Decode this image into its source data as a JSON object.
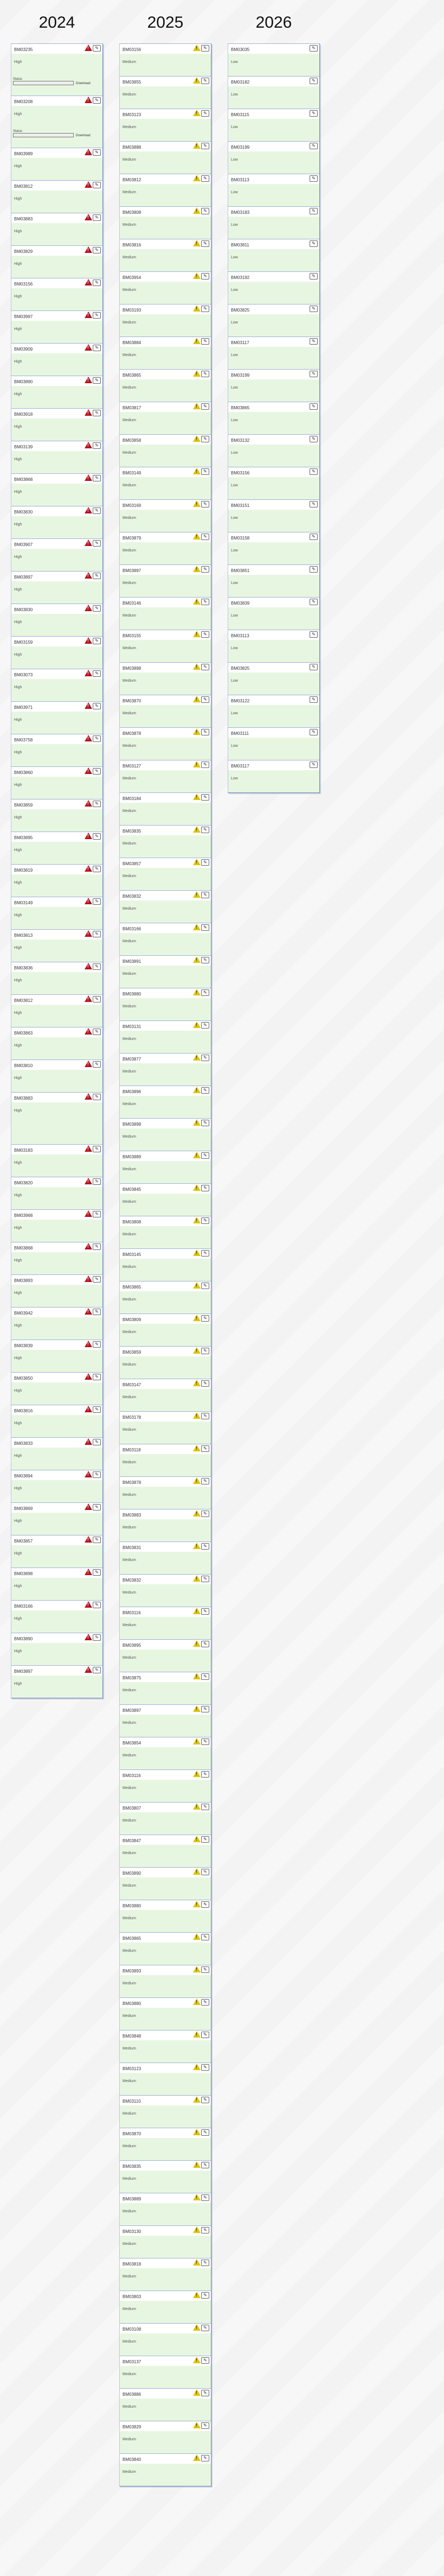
{
  "years": [
    {
      "label": "2024",
      "severity": "High",
      "cards": [
        {
          "id": "BM03235",
          "level": "High",
          "kind": "extra"
        },
        {
          "id": "BM03208",
          "level": "High",
          "kind": "extra2"
        },
        {
          "id": "BM03989",
          "level": "High"
        },
        {
          "id": "BM03812",
          "level": "High"
        },
        {
          "id": "BM03883",
          "level": "High"
        },
        {
          "id": "BM03829",
          "level": "High"
        },
        {
          "id": "BM03156",
          "level": "High"
        },
        {
          "id": "BM03997",
          "level": "High"
        },
        {
          "id": "BM03909",
          "level": "High"
        },
        {
          "id": "BM03890",
          "level": "High"
        },
        {
          "id": "BM03918",
          "level": "High"
        },
        {
          "id": "BM03139",
          "level": "High"
        },
        {
          "id": "BM03868",
          "level": "High"
        },
        {
          "id": "BM03830",
          "level": "High"
        },
        {
          "id": "BM03907",
          "level": "High"
        },
        {
          "id": "BM03897",
          "level": "High"
        },
        {
          "id": "BM03830",
          "level": "High"
        },
        {
          "id": "BM03159",
          "level": "High"
        },
        {
          "id": "BM03073",
          "level": "High"
        },
        {
          "id": "BM03971",
          "level": "High"
        },
        {
          "id": "BM03758",
          "level": "High"
        },
        {
          "id": "BM03860",
          "level": "High"
        },
        {
          "id": "BM03859",
          "level": "High"
        },
        {
          "id": "BM03895",
          "level": "High"
        },
        {
          "id": "BM03819",
          "level": "High"
        },
        {
          "id": "BM03149",
          "level": "High"
        },
        {
          "id": "BM03813",
          "level": "High"
        },
        {
          "id": "BM03836",
          "level": "High"
        },
        {
          "id": "BM03812",
          "level": "High"
        },
        {
          "id": "BM03863",
          "level": "High"
        },
        {
          "id": "BM03810",
          "level": "High"
        },
        {
          "id": "BM03883",
          "level": "High",
          "kind": "big"
        },
        {
          "id": "BM03183",
          "level": "High"
        },
        {
          "id": "BM03820",
          "level": "High"
        },
        {
          "id": "BM03968",
          "level": "High"
        },
        {
          "id": "BM03868",
          "level": "High"
        },
        {
          "id": "BM03893",
          "level": "High"
        },
        {
          "id": "BM03942",
          "level": "High"
        },
        {
          "id": "BM03839",
          "level": "High"
        },
        {
          "id": "BM03850",
          "level": "High"
        },
        {
          "id": "BM03816",
          "level": "High"
        },
        {
          "id": "BM03833",
          "level": "High"
        },
        {
          "id": "BM03894",
          "level": "High"
        },
        {
          "id": "BM03869",
          "level": "High"
        },
        {
          "id": "BM03857",
          "level": "High"
        },
        {
          "id": "BM03898",
          "level": "High"
        },
        {
          "id": "BM03166",
          "level": "High"
        },
        {
          "id": "BM03890",
          "level": "High"
        },
        {
          "id": "BM03897",
          "level": "High"
        }
      ]
    },
    {
      "label": "2025",
      "severity": "Medium",
      "cards": [
        {
          "id": "BM03156",
          "level": "Medium"
        },
        {
          "id": "BM03855",
          "level": "Medium"
        },
        {
          "id": "BM03123",
          "level": "Medium"
        },
        {
          "id": "BM03888",
          "level": "Medium"
        },
        {
          "id": "BM03812",
          "level": "Medium"
        },
        {
          "id": "BM03808",
          "level": "Medium"
        },
        {
          "id": "BM03816",
          "level": "Medium"
        },
        {
          "id": "BM03954",
          "level": "Medium"
        },
        {
          "id": "BM03193",
          "level": "Medium"
        },
        {
          "id": "BM03884",
          "level": "Medium"
        },
        {
          "id": "BM03865",
          "level": "Medium"
        },
        {
          "id": "BM03817",
          "level": "Medium"
        },
        {
          "id": "BM03858",
          "level": "Medium"
        },
        {
          "id": "BM03149",
          "level": "Medium"
        },
        {
          "id": "BM03169",
          "level": "Medium"
        },
        {
          "id": "BM03879",
          "level": "Medium"
        },
        {
          "id": "BM03897",
          "level": "Medium"
        },
        {
          "id": "BM03146",
          "level": "Medium"
        },
        {
          "id": "BM03155",
          "level": "Medium"
        },
        {
          "id": "BM03898",
          "level": "Medium"
        },
        {
          "id": "BM03870",
          "level": "Medium"
        },
        {
          "id": "BM03878",
          "level": "Medium"
        },
        {
          "id": "BM03127",
          "level": "Medium"
        },
        {
          "id": "BM03184",
          "level": "Medium"
        },
        {
          "id": "BM03835",
          "level": "Medium"
        },
        {
          "id": "BM03857",
          "level": "Medium"
        },
        {
          "id": "BM03832",
          "level": "Medium"
        },
        {
          "id": "BM03166",
          "level": "Medium"
        },
        {
          "id": "BM03891",
          "level": "Medium"
        },
        {
          "id": "BM03880",
          "level": "Medium"
        },
        {
          "id": "BM03131",
          "level": "Medium"
        },
        {
          "id": "BM03877",
          "level": "Medium"
        },
        {
          "id": "BM03896",
          "level": "Medium"
        },
        {
          "id": "BM03898",
          "level": "Medium"
        },
        {
          "id": "BM03889",
          "level": "Medium"
        },
        {
          "id": "BM03845",
          "level": "Medium"
        },
        {
          "id": "BM03808",
          "level": "Medium"
        },
        {
          "id": "BM03145",
          "level": "Medium"
        },
        {
          "id": "BM03865",
          "level": "Medium"
        },
        {
          "id": "BM03809",
          "level": "Medium"
        },
        {
          "id": "BM03859",
          "level": "Medium"
        },
        {
          "id": "BM03147",
          "level": "Medium"
        },
        {
          "id": "BM03178",
          "level": "Medium"
        },
        {
          "id": "BM03118",
          "level": "Medium"
        },
        {
          "id": "BM03878",
          "level": "Medium"
        },
        {
          "id": "BM03883",
          "level": "Medium"
        },
        {
          "id": "BM03831",
          "level": "Medium"
        },
        {
          "id": "BM03832",
          "level": "Medium"
        },
        {
          "id": "BM03116",
          "level": "Medium"
        },
        {
          "id": "BM03895",
          "level": "Medium"
        },
        {
          "id": "BM03875",
          "level": "Medium"
        },
        {
          "id": "BM03897",
          "level": "Medium"
        },
        {
          "id": "BM03854",
          "level": "Medium"
        },
        {
          "id": "BM03116",
          "level": "Medium"
        },
        {
          "id": "BM03807",
          "level": "Medium"
        },
        {
          "id": "BM03847",
          "level": "Medium"
        },
        {
          "id": "BM03890",
          "level": "Medium"
        },
        {
          "id": "BM03880",
          "level": "Medium"
        },
        {
          "id": "BM03865",
          "level": "Medium"
        },
        {
          "id": "BM03893",
          "level": "Medium"
        },
        {
          "id": "BM03880",
          "level": "Medium"
        },
        {
          "id": "BM03848",
          "level": "Medium"
        },
        {
          "id": "BM03123",
          "level": "Medium"
        },
        {
          "id": "BM03110",
          "level": "Medium"
        },
        {
          "id": "BM03870",
          "level": "Medium"
        },
        {
          "id": "BM03835",
          "level": "Medium"
        },
        {
          "id": "BM03889",
          "level": "Medium"
        },
        {
          "id": "BM03130",
          "level": "Medium"
        },
        {
          "id": "BM03818",
          "level": "Medium"
        },
        {
          "id": "BM03803",
          "level": "Medium"
        },
        {
          "id": "BM03108",
          "level": "Medium"
        },
        {
          "id": "BM03137",
          "level": "Medium"
        },
        {
          "id": "BM03886",
          "level": "Medium"
        },
        {
          "id": "BM03829",
          "level": "Medium"
        },
        {
          "id": "BM03840",
          "level": "Medium"
        }
      ]
    },
    {
      "label": "2026",
      "severity": "Low",
      "cards": [
        {
          "id": "BM03035",
          "level": "Low"
        },
        {
          "id": "BM03182",
          "level": "Low"
        },
        {
          "id": "BM03115",
          "level": "Low"
        },
        {
          "id": "BM03199",
          "level": "Low"
        },
        {
          "id": "BM03113",
          "level": "Low"
        },
        {
          "id": "BM03183",
          "level": "Low"
        },
        {
          "id": "BM03811",
          "level": "Low"
        },
        {
          "id": "BM03192",
          "level": "Low"
        },
        {
          "id": "BM03825",
          "level": "Low"
        },
        {
          "id": "BM03117",
          "level": "Low"
        },
        {
          "id": "BM03199",
          "level": "Low"
        },
        {
          "id": "BM03865",
          "level": "Low"
        },
        {
          "id": "BM03132",
          "level": "Low"
        },
        {
          "id": "BM03156",
          "level": "Low"
        },
        {
          "id": "BM03151",
          "level": "Low"
        },
        {
          "id": "BM03158",
          "level": "Low"
        },
        {
          "id": "BM03851",
          "level": "Low"
        },
        {
          "id": "BM03839",
          "level": "Low"
        },
        {
          "id": "BM03113",
          "level": "Low"
        },
        {
          "id": "BM03825",
          "level": "Low"
        },
        {
          "id": "BM03122",
          "level": "Low"
        },
        {
          "id": "BM03111",
          "level": "Low"
        },
        {
          "id": "BM03117",
          "level": "Low"
        }
      ]
    }
  ],
  "extra_labels": {
    "status_label": "Status",
    "button_label": "Download"
  },
  "icons": {
    "high": "warning-triangle-red",
    "medium": "warning-triangle-yellow",
    "low": "low-marker",
    "edit": "edit-icon"
  },
  "colors": {
    "high": "#b3121b",
    "medium": "#e0c400",
    "card_bg": "#e7f6e1",
    "border": "#6d8bbf"
  }
}
